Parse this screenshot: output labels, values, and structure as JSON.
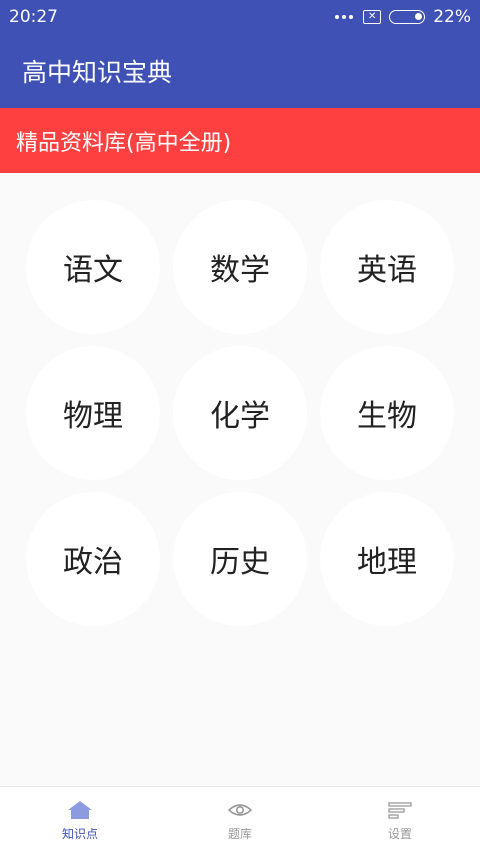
{
  "status_bar": {
    "time": "20:27",
    "battery": "22%",
    "icons": [
      "more-dots-icon",
      "sim-card-icon",
      "battery-icon"
    ]
  },
  "toolbar": {
    "title": "高中知识宝典"
  },
  "banner": {
    "text": "精品资料库(高中全册)"
  },
  "subjects": [
    {
      "label": "语文"
    },
    {
      "label": "数学"
    },
    {
      "label": "英语"
    },
    {
      "label": "物理"
    },
    {
      "label": "化学"
    },
    {
      "label": "生物"
    },
    {
      "label": "政治"
    },
    {
      "label": "历史"
    },
    {
      "label": "地理"
    }
  ],
  "bottom_nav": [
    {
      "label": "知识点",
      "icon": "home-icon",
      "active": true
    },
    {
      "label": "题库",
      "icon": "eye-icon",
      "active": false
    },
    {
      "label": "设置",
      "icon": "settings-lines-icon",
      "active": false
    }
  ],
  "colors": {
    "primary": "#3f51b5",
    "banner": "#ff4040",
    "active_nav": "#3f51b5",
    "inactive_nav": "#999999"
  }
}
